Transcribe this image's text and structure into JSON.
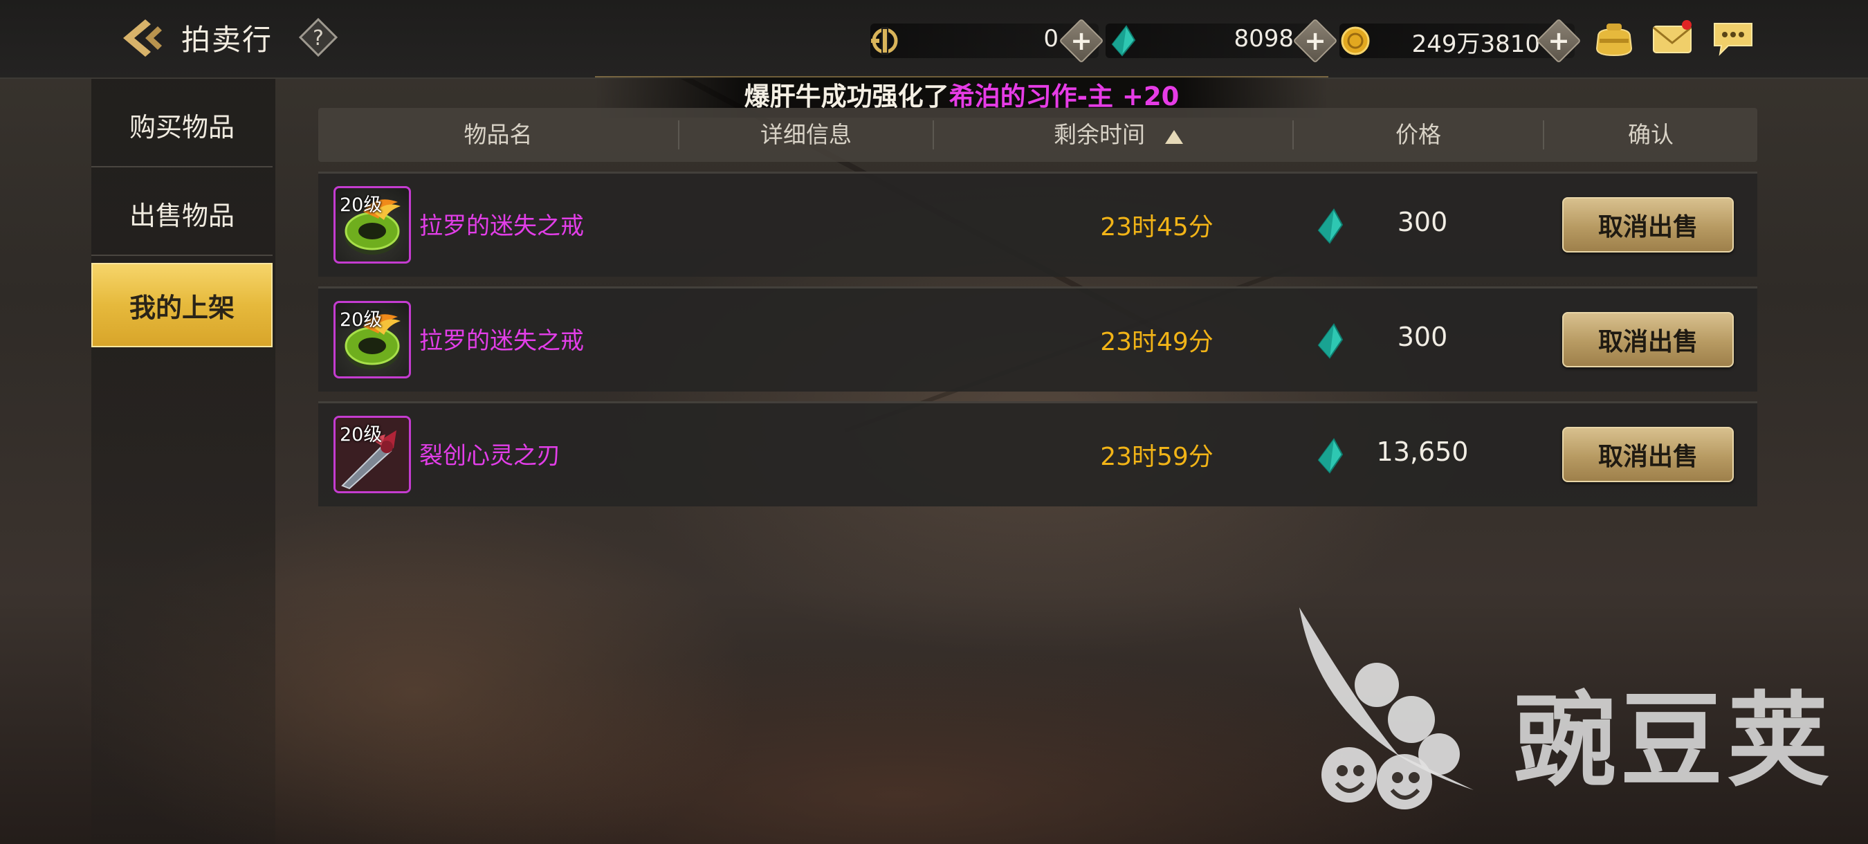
{
  "header": {
    "title": "拍卖行",
    "currencies": [
      {
        "icon": "honor-coin-icon",
        "value": "0"
      },
      {
        "icon": "teal-gem-icon",
        "value": "8098"
      },
      {
        "icon": "gold-coin-icon",
        "value": "249万3810"
      }
    ],
    "icons": [
      "pouch-icon",
      "mail-icon",
      "chat-icon"
    ]
  },
  "broadcast": {
    "prefix": "爆肝牛成功强化了",
    "highlight": "希泊的习作-主 +20"
  },
  "sidebar": {
    "items": [
      {
        "label": "购买物品"
      },
      {
        "label": "出售物品"
      },
      {
        "label": "我的上架"
      }
    ],
    "active_index": 2
  },
  "table": {
    "columns": [
      "物品名",
      "详细信息",
      "剩余时间",
      "价格",
      "确认"
    ],
    "sort_column": "剩余时间",
    "rows": [
      {
        "level": "20级",
        "name": "拉罗的迷失之戒",
        "time": "23时45分",
        "price": "300",
        "action": "取消出售",
        "item_icon": "green-ring-icon"
      },
      {
        "level": "20级",
        "name": "拉罗的迷失之戒",
        "time": "23时49分",
        "price": "300",
        "action": "取消出售",
        "item_icon": "green-ring-icon"
      },
      {
        "level": "20级",
        "name": "裂创心灵之刃",
        "time": "23时59分",
        "price": "13,650",
        "action": "取消出售",
        "item_icon": "blade-icon"
      }
    ]
  },
  "watermark": {
    "text": "豌豆荚"
  },
  "colors": {
    "accent_gold": "#e6b93c",
    "item_name_magenta": "#e23ee8",
    "time_orange": "#f2b417"
  }
}
